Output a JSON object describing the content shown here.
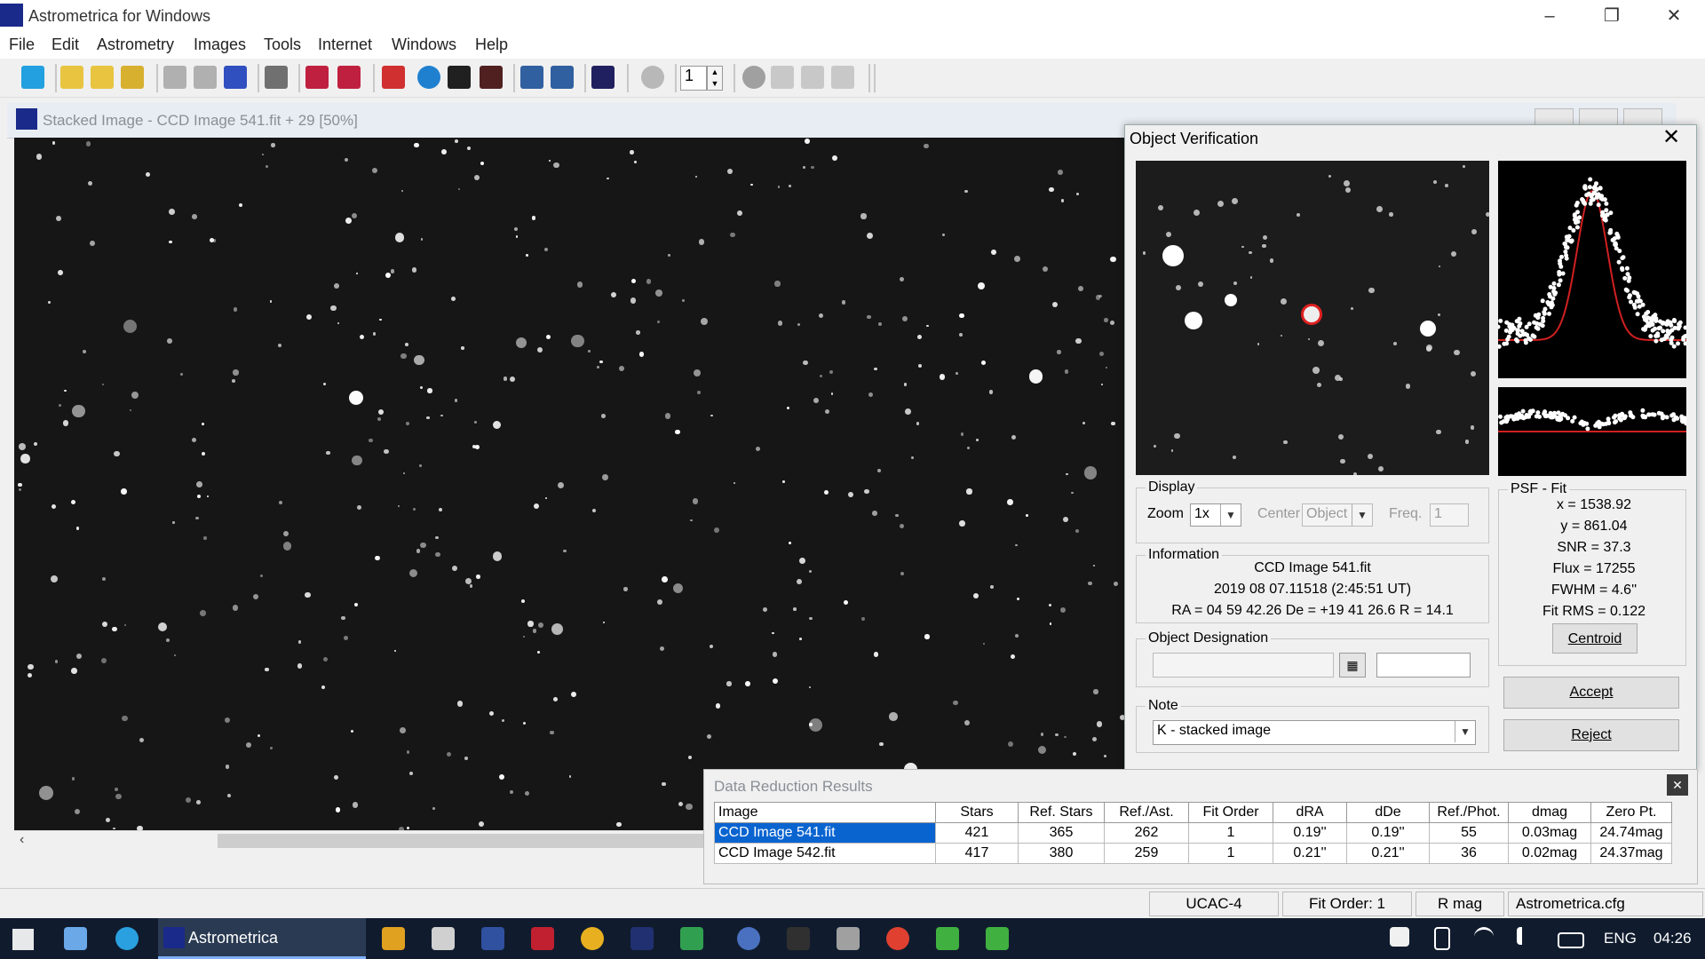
{
  "app": {
    "title": "Astrometrica for Windows"
  },
  "menu": [
    "File",
    "Edit",
    "Astrometry",
    "Images",
    "Tools",
    "Internet",
    "Windows",
    "Help"
  ],
  "toolbar": {
    "frame_value": "1"
  },
  "image_window": {
    "title": "Stacked Image - CCD Image 541.fit + 29 [50%]"
  },
  "object_verification": {
    "title": "Object Verification",
    "display": {
      "legend": "Display",
      "zoom_label": "Zoom",
      "zoom_value": "1x",
      "center_label": "Center",
      "center_value": "Object",
      "freq_label": "Freq.",
      "freq_value": "1"
    },
    "information": {
      "legend": "Information",
      "line1": "CCD Image 541.fit",
      "line2": "2019 08 07.11518 (2:45:51 UT)",
      "line3": "RA = 04 59 42.26   De = +19 41 26.6   R = 14.1"
    },
    "designation": {
      "legend": "Object Designation",
      "value": "",
      "value2": ""
    },
    "note": {
      "legend": "Note",
      "value": "K - stacked image"
    },
    "psf": {
      "legend": "PSF - Fit",
      "x": "x = 1538.92",
      "y": "y = 861.04",
      "snr": "SNR = 37.3",
      "flux": "Flux = 17255",
      "fwhm": "FWHM = 4.6''",
      "fitrms": "Fit RMS = 0.122",
      "centroid_label": "Centroid"
    },
    "accept_label": "Accept",
    "reject_label": "Reject"
  },
  "data_reduction": {
    "title": "Data Reduction Results",
    "columns": [
      "Image",
      "Stars",
      "Ref. Stars",
      "Ref./Ast.",
      "Fit Order",
      "dRA",
      "dDe",
      "Ref./Phot.",
      "dmag",
      "Zero Pt."
    ],
    "rows": [
      [
        "CCD Image 541.fit",
        "421",
        "365",
        "262",
        "1",
        "0.19''",
        "0.19''",
        "55",
        "0.03mag",
        "24.74mag"
      ],
      [
        "CCD Image 542.fit",
        "417",
        "380",
        "259",
        "1",
        "0.21''",
        "0.21''",
        "36",
        "0.02mag",
        "24.37mag"
      ]
    ]
  },
  "status": {
    "catalog": "UCAC-4",
    "fit_order": "Fit Order: 1",
    "mag": "R mag",
    "config": "Astrometrica.cfg"
  },
  "taskbar": {
    "active_app": "Astrometrica",
    "lang": "ENG",
    "time": "04:26"
  }
}
